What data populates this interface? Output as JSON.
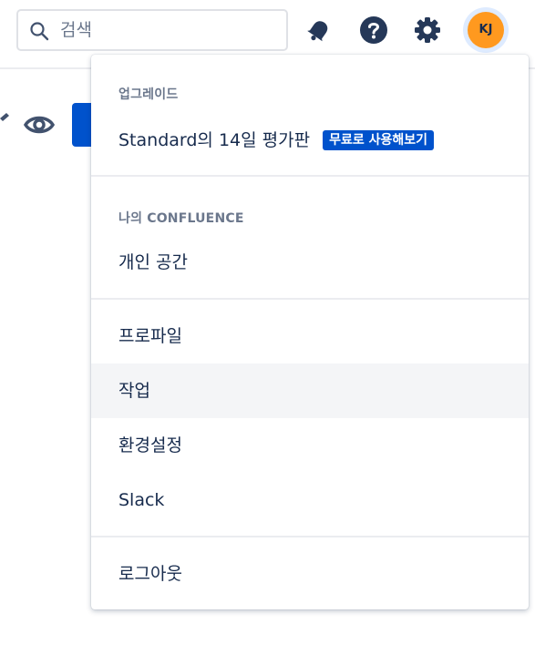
{
  "search": {
    "placeholder": "검색"
  },
  "header": {
    "icons": [
      "notifications-icon",
      "help-icon",
      "settings-icon"
    ],
    "avatar_initials": "KJ"
  },
  "menu": {
    "upgrade": {
      "heading": "업그레이드",
      "trial_label": "Standard의 14일 평가판",
      "trial_badge": "무료로 사용해보기"
    },
    "my_confluence": {
      "heading": "나의 CONFLUENCE",
      "items": [
        "개인 공간"
      ]
    },
    "account": {
      "items": [
        "프로파일",
        "작업",
        "환경설정",
        "Slack"
      ]
    },
    "logout": {
      "label": "로그아웃"
    }
  },
  "colors": {
    "accent": "#0052cc",
    "avatar_bg": "#ff991f",
    "text": "#172b4d",
    "muted": "#6b778c",
    "hover_bg": "#f4f5f7"
  }
}
